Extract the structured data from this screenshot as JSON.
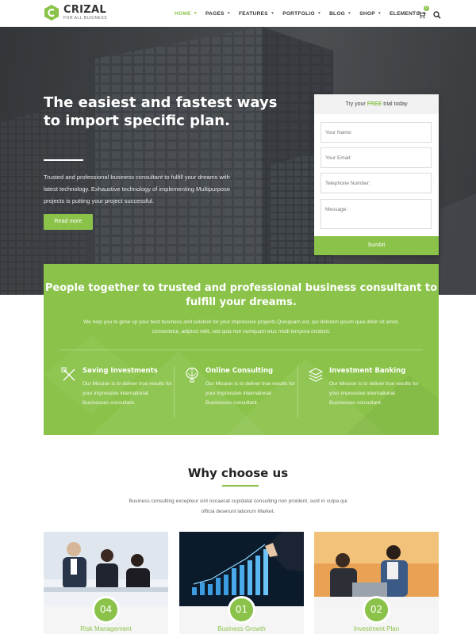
{
  "header": {
    "logo_name": "CRIZAL",
    "logo_tag": "FOR ALL BUSINESS",
    "nav": [
      {
        "label": "HOME",
        "active": true
      },
      {
        "label": "PAGES"
      },
      {
        "label": "FEATURES"
      },
      {
        "label": "PORTFOLIO"
      },
      {
        "label": "BLOG"
      },
      {
        "label": "SHOP"
      },
      {
        "label": "ELEMENTS"
      }
    ],
    "cart_count": "0"
  },
  "hero": {
    "title": "The easiest and fastest ways to import specific plan.",
    "text": "Trusted and professional business consultant to fulfill your dreams with latest technology. Exhaustive technology of implementing Multipurpose projects is putting your project successful.",
    "button": "Read more"
  },
  "form": {
    "head_pre": "Try your ",
    "head_free": "FREE",
    "head_post": " trial today",
    "name_placeholder": "Your Name:",
    "email_placeholder": "Your Email:",
    "phone_placeholder": "Telephone Number:",
    "message_placeholder": "Message:",
    "submit": "Sumbit"
  },
  "band": {
    "title": "People together to trusted and professional business consultant to fulfill your dreams.",
    "text": "We help you to grow up your best business and solution for your impressive projects.Quisquam est, qui dolorem ipsum quia dolor sit amet, consectetur, adipisci velit, sed quia non numquam eius modi tempora incidunt.",
    "features": [
      {
        "title": "Saving Investments",
        "text": "Our Mission is to deliver true results for your impressive international Businesses consultant.",
        "icon": "pencil-ruler-icon"
      },
      {
        "title": "Online Consulting",
        "text": "Our Mission is to deliver true results for your impressive international Businesses consultant.",
        "icon": "balloon-icon"
      },
      {
        "title": "Investment Banking",
        "text": "Our Mission is to deliver true results for your impressive international Businesses consultant.",
        "icon": "layers-icon"
      }
    ]
  },
  "why": {
    "title": "Why choose us",
    "text": "Business consulting excepteur sint occaecat cupidatat consulting non proident, sunt in culpa qui officia deserunt laborum Market.",
    "cards": [
      {
        "num": "04",
        "title": "Risk Management"
      },
      {
        "num": "01",
        "title": "Business Growth"
      },
      {
        "num": "02",
        "title": "Investment Plan"
      }
    ]
  },
  "colors": {
    "accent": "#8bc34a",
    "dark": "#222222"
  }
}
